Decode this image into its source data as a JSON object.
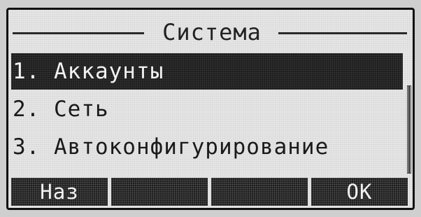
{
  "screen": {
    "title": "Система"
  },
  "menu": {
    "items": [
      {
        "label": "1. Аккаунты",
        "selected": true
      },
      {
        "label": "2. Сеть",
        "selected": false
      },
      {
        "label": "3. Автоконфигурирование",
        "selected": false
      }
    ]
  },
  "softkeys": {
    "key1": "Наз",
    "key2": "",
    "key3": "",
    "key4": "OK"
  },
  "colors": {
    "lcd_background": "#e6e6e6",
    "highlight": "#1e1e1e",
    "text": "#1a1a1a"
  }
}
